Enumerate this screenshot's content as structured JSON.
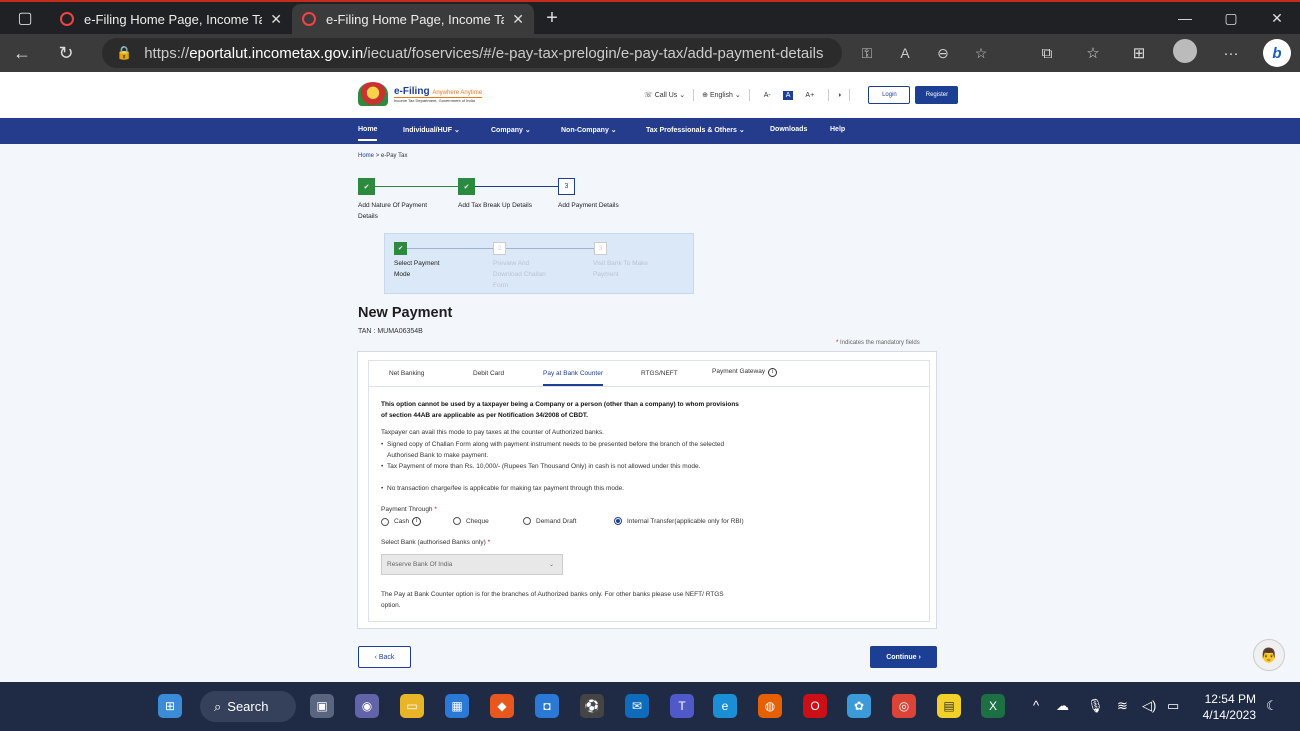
{
  "browser": {
    "tabs": [
      {
        "title": "e-Filing Home Page, Income Tax |"
      },
      {
        "title": "e-Filing Home Page, Income Tax |"
      }
    ],
    "url_prefix": "https://",
    "url_host": "eportalut.incometax.gov.in",
    "url_path": "/iecuat/foservices/#/e-pay-tax-prelogin/e-pay-tax/add-payment-details"
  },
  "header": {
    "logo_title": "e-Filing",
    "logo_tagline": "Anywhere Anytime",
    "logo_sub": "Income Tax Department, Government of India",
    "call_us": "Call Us",
    "language": "English",
    "font_small": "A-",
    "font_normal": "A",
    "font_large": "A+",
    "login": "Login",
    "register": "Register"
  },
  "nav": {
    "home": "Home",
    "individual": "Individual/HUF",
    "company": "Company",
    "non_company": "Non-Company",
    "tax_professionals": "Tax Professionals & Others",
    "downloads": "Downloads",
    "help": "Help"
  },
  "breadcrumb": {
    "home": "Home",
    "sep": ">",
    "current": "e-Pay Tax"
  },
  "stepper": {
    "steps": [
      {
        "label": "Add Nature Of Payment Details",
        "status": "done"
      },
      {
        "label": "Add Tax Break Up Details",
        "status": "done"
      },
      {
        "label": "Add Payment Details",
        "status": "current",
        "number": "3"
      }
    ],
    "substeps": [
      {
        "label": "Select Payment Mode",
        "status": "done"
      },
      {
        "label": "Preview And Download Challan Form",
        "status": "todo",
        "number": "2"
      },
      {
        "label": "Visit Bank To Make Payment",
        "status": "todo",
        "number": "3"
      }
    ]
  },
  "main": {
    "title": "New Payment",
    "tan": "TAN : MUMA06354B",
    "mandatory_note": "Indicates the mandatory fields",
    "tabs": [
      "Net Banking",
      "Debit Card",
      "Pay at Bank Counter",
      "RTGS/NEFT",
      "Payment Gateway"
    ],
    "active_tab": "Pay at Bank Counter",
    "warning": "This option cannot be used by a taxpayer being a Company or a person (other than a company) to whom provisions of section 44AB are applicable as per Notification 34/2008 of CBDT.",
    "intro": "Taxpayer can avail this mode to pay taxes at the counter of Authorized banks.",
    "bullets": [
      "Signed copy of Challan Form along with payment instrument needs to be presented before the branch of the selected Authorised Bank to make payment.",
      "Tax Payment of more than Rs. 10,000/- (Rupees Ten Thousand Only) in cash is not allowed under this mode.",
      "No transaction charge/fee is applicable for making tax payment through this mode."
    ],
    "payment_through_label": "Payment Through",
    "payment_options": [
      "Cash",
      "Cheque",
      "Demand Draft",
      "Internal Transfer(applicable only for RBI)"
    ],
    "selected_option": "Internal Transfer(applicable only for RBI)",
    "select_bank_label": "Select Bank (authorised Banks only)",
    "select_bank_value": "Reserve Bank Of India",
    "footer_note": "The Pay at Bank Counter option is for the branches of Authorized banks only. For other banks please use NEFT/ RTGS option.",
    "back": "Back",
    "continue": "Continue"
  },
  "taskbar": {
    "search": "Search",
    "time": "12:54 PM",
    "date": "4/14/2023"
  },
  "colors": {
    "primary": "#1c3f94",
    "nav": "#253b8c",
    "success": "#2b8a3e",
    "frame": "#c42b1c"
  }
}
